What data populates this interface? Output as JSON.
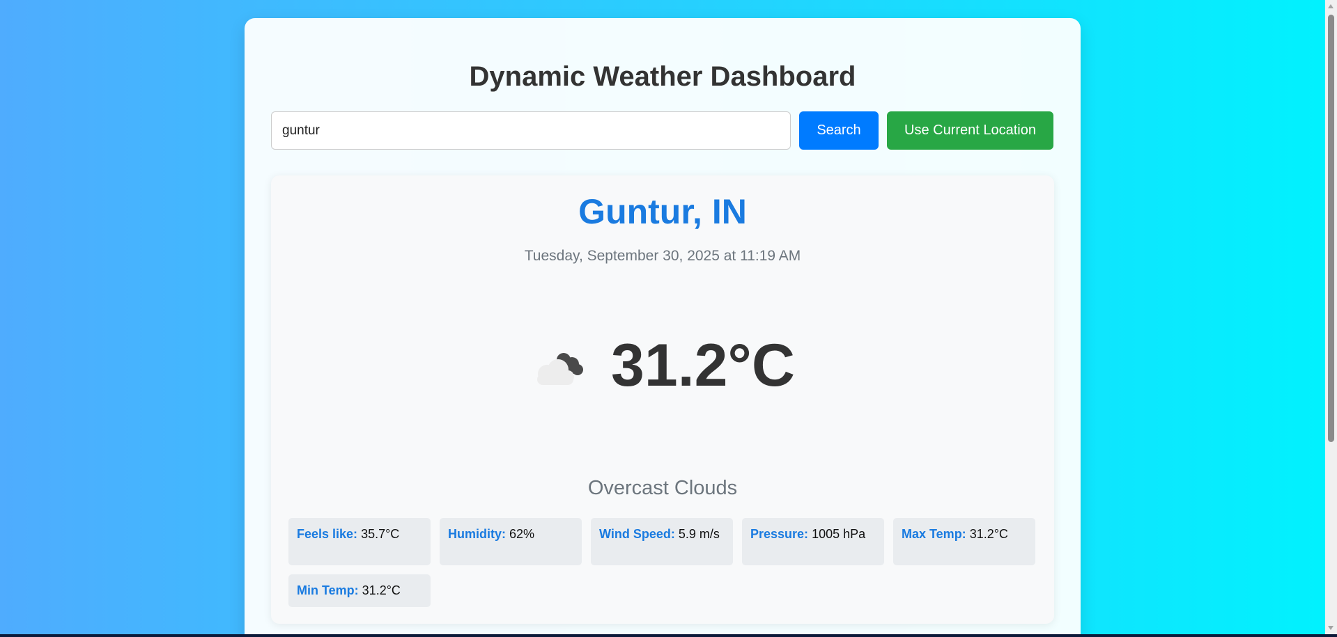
{
  "app": {
    "title": "Dynamic Weather Dashboard"
  },
  "search": {
    "value": "guntur",
    "placeholder": "",
    "search_label": "Search",
    "location_label": "Use Current Location"
  },
  "weather": {
    "city": "Guntur, IN",
    "datetime": "Tuesday, September 30, 2025 at 11:19 AM",
    "icon": "overcast-clouds-icon",
    "temperature": "31.2°C",
    "condition": "Overcast Clouds"
  },
  "details": [
    {
      "label": "Feels like:",
      "value": "35.7°C"
    },
    {
      "label": "Humidity:",
      "value": "62%"
    },
    {
      "label": "Wind Speed:",
      "value": "5.9 m/s"
    },
    {
      "label": "Pressure:",
      "value": "1005 hPa"
    },
    {
      "label": "Max Temp:",
      "value": "31.2°C"
    },
    {
      "label": "Min Temp:",
      "value": "31.2°C"
    }
  ],
  "colors": {
    "background_start": "#4facfe",
    "background_end": "#00f2fe",
    "accent_blue": "#007bff",
    "accent_green": "#28a745",
    "city_color": "#1a7be0"
  }
}
